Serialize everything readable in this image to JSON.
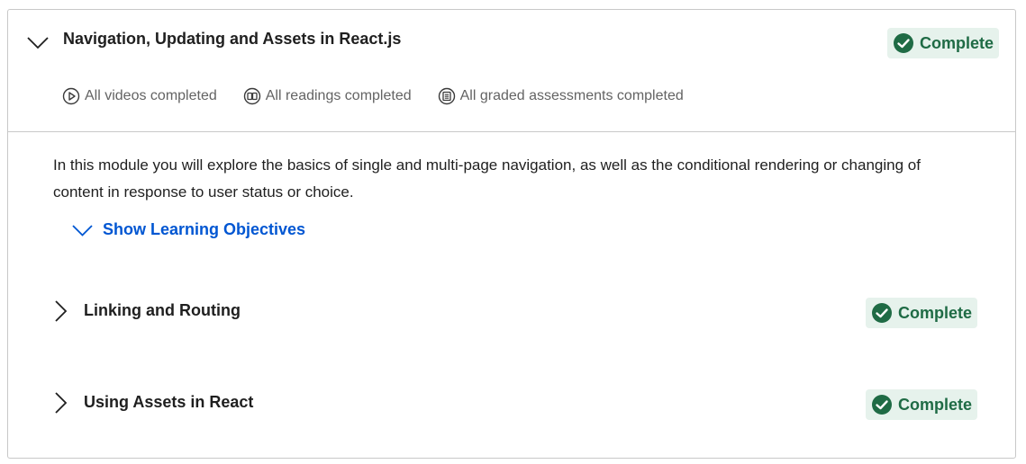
{
  "module": {
    "title": "Navigation, Updating and Assets in React.js",
    "status": "Complete",
    "stats": [
      {
        "icon": "play-circle-icon",
        "label": "All videos completed"
      },
      {
        "icon": "book-open-icon",
        "label": "All readings completed"
      },
      {
        "icon": "assignment-icon",
        "label": "All graded assessments completed"
      }
    ],
    "description": "In this module you will explore the basics of single and multi-page navigation, as well as the conditional rendering or changing of content in response to user status or choice.",
    "show_objectives_label": "Show Learning Objectives"
  },
  "lessons": [
    {
      "title": "Linking and Routing",
      "status": "Complete"
    },
    {
      "title": "Using Assets in React",
      "status": "Complete"
    }
  ],
  "colors": {
    "complete_bg": "#e6f2ec",
    "complete_text": "#1f6b45",
    "link": "#0056d2",
    "border": "#c8c8c8"
  }
}
